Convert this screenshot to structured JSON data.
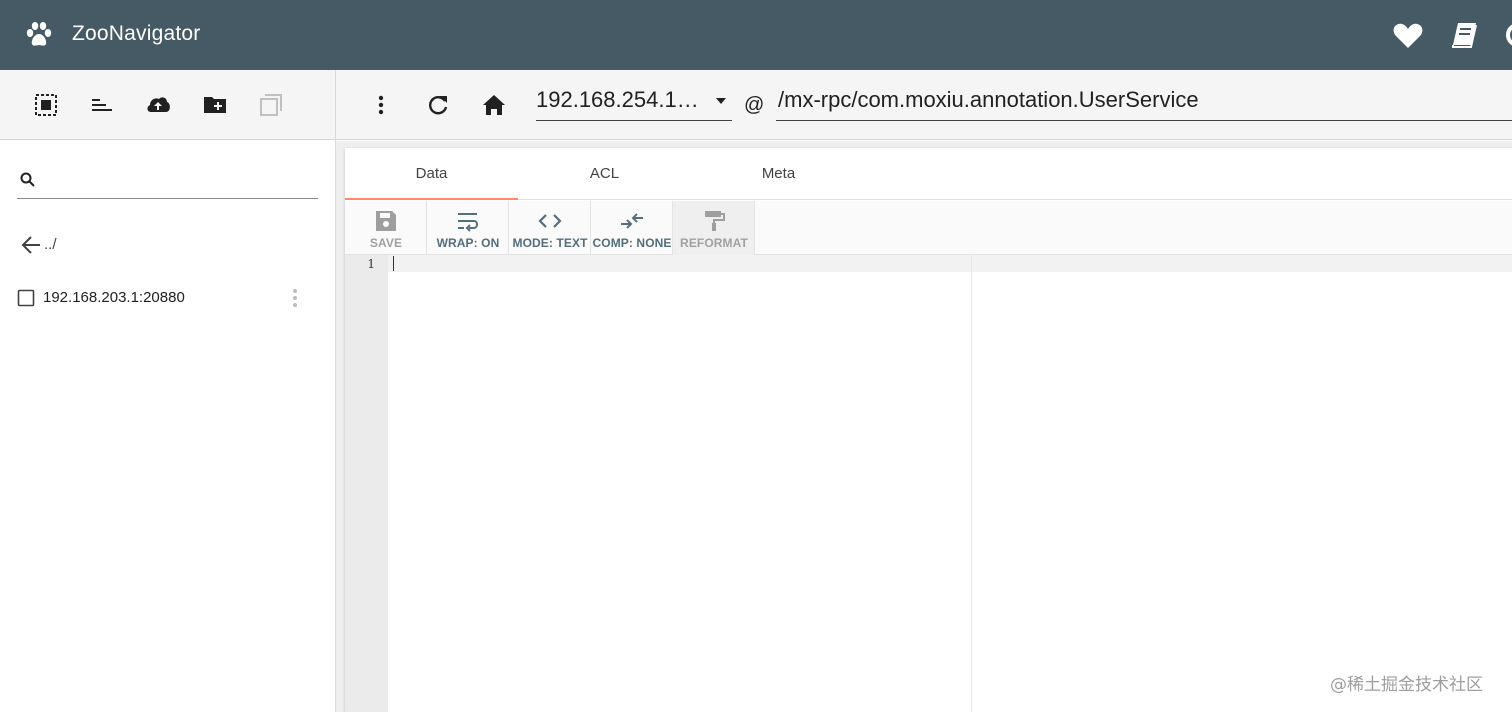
{
  "app": {
    "title": "ZooNavigator",
    "header_icons": [
      "paw-icon",
      "heart-icon",
      "book-icon"
    ]
  },
  "left_toolbar": {
    "icons": [
      "select-all-icon",
      "sort-icon",
      "upload-icon",
      "create-folder-icon",
      "duplicate-icon"
    ]
  },
  "sidebar": {
    "search": {
      "value": "",
      "placeholder": ""
    },
    "parent_label": "../",
    "nodes": [
      {
        "label": "192.168.203.1:20880"
      }
    ]
  },
  "main_toolbar": {
    "connection": "192.168.254.10...",
    "at": "@",
    "path": "/mx-rpc/com.moxiu.annotation.UserService"
  },
  "tabs": [
    {
      "label": "Data",
      "active": true
    },
    {
      "label": "ACL",
      "active": false
    },
    {
      "label": "Meta",
      "active": false
    }
  ],
  "editor_toolbar": {
    "save": "SAVE",
    "wrap": "WRAP: ON",
    "mode": "MODE: TEXT",
    "comp": "COMP: NONE",
    "reformat": "REFORMAT"
  },
  "editor": {
    "line_numbers": [
      "1"
    ],
    "content": ""
  },
  "watermark": "@稀土掘金技术社区",
  "colors": {
    "appbar": "#455a64",
    "tab_indicator": "#ff8a65",
    "toolbar_label": "#546e7a"
  }
}
